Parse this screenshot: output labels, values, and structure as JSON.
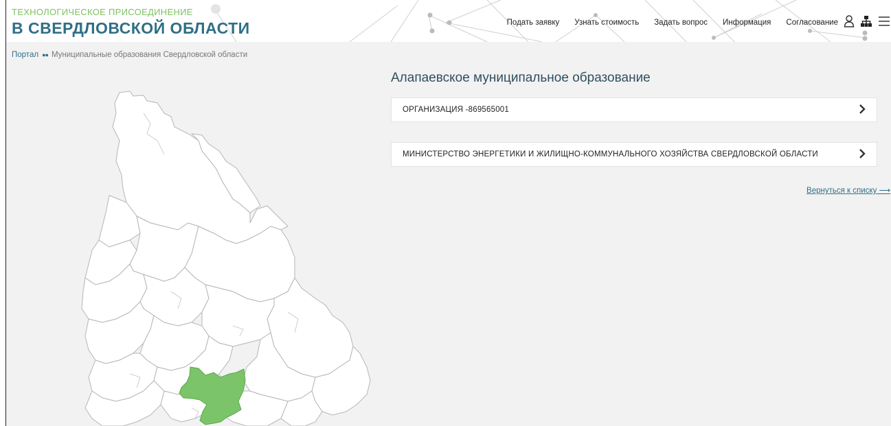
{
  "header": {
    "logo_top": "ТЕХНОЛОГИЧЕСКОЕ ПРИСОЕДИНЕНИЕ",
    "logo_main": "В СВЕРДЛОВСКОЙ ОБЛАСТИ",
    "nav": [
      {
        "label": "Подать заявку"
      },
      {
        "label": "Узнать стоимость"
      },
      {
        "label": "Задать вопрос"
      },
      {
        "label": "Информация"
      },
      {
        "label": "Согласование"
      }
    ],
    "icons": [
      "user-icon",
      "sitemap-icon",
      "menu-icon"
    ]
  },
  "breadcrumb": {
    "home": "Портал",
    "separator": "●●",
    "current": "Муниципальные образования Свердловской области"
  },
  "main": {
    "title": "Алапаевское муниципальное образование",
    "items": [
      {
        "label": "ОРГАНИЗАЦИЯ -869565001"
      },
      {
        "label": "МИНИСТЕРСТВО ЭНЕРГЕТИКИ И ЖИЛИЩНО-КОММУНАЛЬНОГО ХОЗЯЙСТВА СВЕРДЛОВСКОЙ ОБЛАСТИ"
      }
    ],
    "back_link": "Вернуться к списку ⟶"
  },
  "colors": {
    "accent": "#2f6f86",
    "logo_green": "#7cc260",
    "highlight_region": "#7cc46a",
    "background": "#f2f2f2"
  }
}
